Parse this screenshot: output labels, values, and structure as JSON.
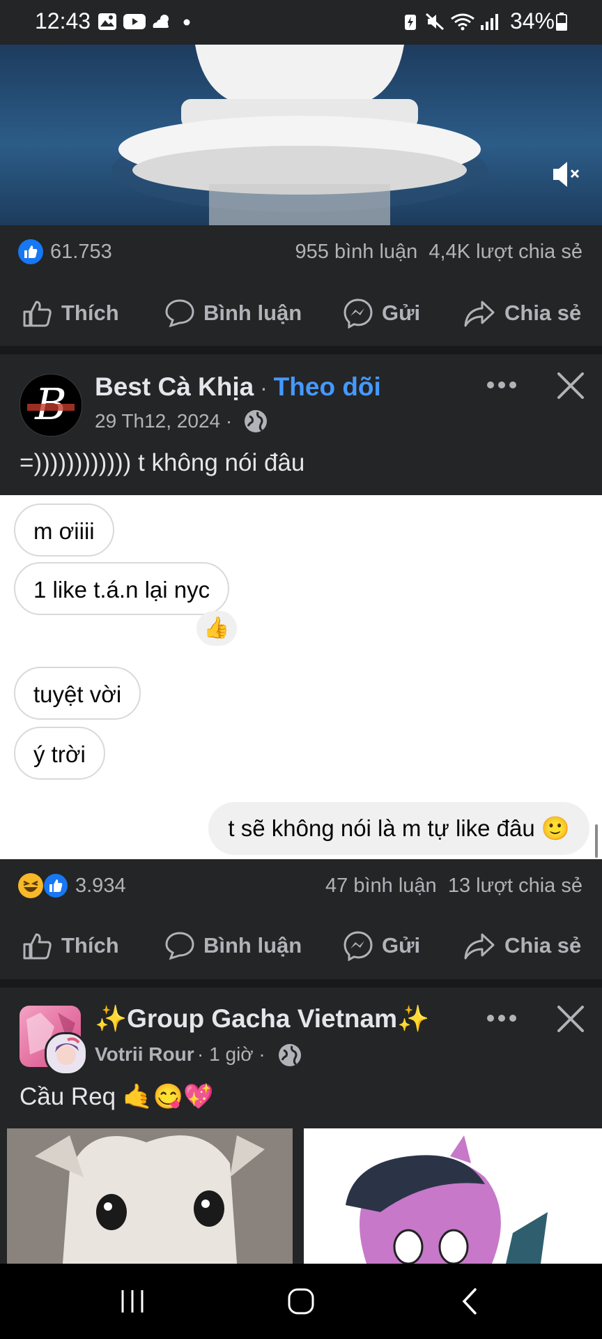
{
  "status_bar": {
    "time": "12:43",
    "battery": "34%"
  },
  "post1": {
    "reaction_count": "61.753",
    "comments": "955 bình luận",
    "shares": "4,4K lượt chia sẻ"
  },
  "actions": {
    "like": "Thích",
    "comment": "Bình luận",
    "send": "Gửi",
    "share": "Chia sẻ"
  },
  "post2": {
    "page_name": "Best Cà Khịa",
    "follow_sep": " · ",
    "follow": "Theo dõi",
    "date": "29 Th12, 2024 ·",
    "caption": "=)))))))))))) t không nói đâu",
    "chat": {
      "left_bubbles": [
        "m ơiiii",
        "1 like t.á.n lại nyc",
        "tuyệt vời",
        "ý trời"
      ],
      "reaction_emoji": "👍",
      "right_bubble": "t sẽ không nói là m tự like đâu 🙂"
    },
    "reaction_count": "3.934",
    "comments": "47 bình luận",
    "shares": "13 lượt chia sẻ"
  },
  "post3": {
    "group_name": "✨Group Gacha Vietnam✨",
    "author": "Votrii Rour",
    "time": "· 1 giờ ·",
    "caption": "Cầu Req 🤙😋💖"
  },
  "colors": {
    "bg": "#242526",
    "link_blue": "#4599ff",
    "like_blue": "#1877f2"
  }
}
